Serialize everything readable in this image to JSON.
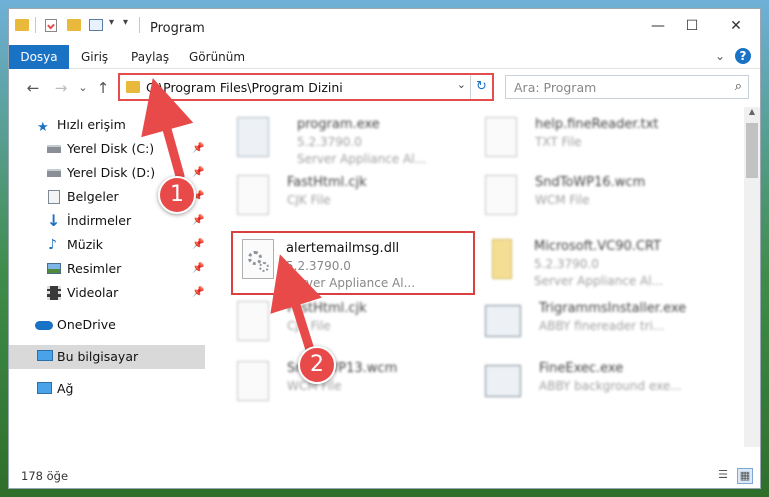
{
  "window": {
    "title": "Program",
    "controls": {
      "minimize": "—",
      "maximize": "☐",
      "close": "✕"
    }
  },
  "ribbon": {
    "tabs": [
      "Dosya",
      "Giriş",
      "Paylaş",
      "Görünüm"
    ],
    "expand": "⌄",
    "help": "?"
  },
  "nav": {
    "back": "←",
    "forward": "→",
    "recent": "⌄",
    "up": "↑",
    "address": "C:\\Program Files\\Program Dizini",
    "address_dropdown": "⌄",
    "refresh": "↻",
    "search_placeholder": "Ara: Program",
    "search_icon": "⌕"
  },
  "sidebar": {
    "quick_access": "Hızlı erişim",
    "items": [
      {
        "label": "Yerel Disk (C:)",
        "icon": "drive-icon",
        "pinned": true
      },
      {
        "label": "Yerel Disk (D:)",
        "icon": "drive-icon",
        "pinned": true
      },
      {
        "label": "Belgeler",
        "icon": "document-icon",
        "pinned": true
      },
      {
        "label": "İndirmeler",
        "icon": "download-icon",
        "pinned": true
      },
      {
        "label": "Müzik",
        "icon": "music-icon",
        "pinned": true
      },
      {
        "label": "Resimler",
        "icon": "picture-icon",
        "pinned": true
      },
      {
        "label": "Videolar",
        "icon": "video-icon",
        "pinned": true
      }
    ],
    "onedrive": "OneDrive",
    "this_pc": "Bu bilgisayar",
    "network": "Ağ",
    "pin_glyph": "📌"
  },
  "files": [
    {
      "name": "program.exe",
      "line2": "5.2.3790.0",
      "line3": "Server Appliance Al...",
      "blurred": true
    },
    {
      "name": "help.fineReader.txt",
      "line2": "TXT File",
      "line3": "",
      "blurred": true
    },
    {
      "name": "FastHtml.cjk",
      "line2": "CJK File",
      "line3": "",
      "blurred": true
    },
    {
      "name": "SndToWP16.wcm",
      "line2": "WCM File",
      "line3": "",
      "blurred": true
    },
    {
      "name": "alertemailmsg.dll",
      "line2": "5.2.3790.0",
      "line3": "Server Appliance Al...",
      "blurred": false
    },
    {
      "name": "Microsoft.VC90.CRT",
      "line2": "5.2.3790.0",
      "line3": "Server Appliance Al...",
      "blurred": true
    },
    {
      "name": "FastHtml.cjk",
      "line2": "CJK File",
      "line3": "",
      "blurred": true
    },
    {
      "name": "TrigrammsInstaller.exe",
      "line2": "ABBY finereader tri...",
      "line3": "",
      "blurred": true
    },
    {
      "name": "SndToWP13.wcm",
      "line2": "WCM File",
      "line3": "",
      "blurred": true
    },
    {
      "name": "FineExec.exe",
      "line2": "ABBY background exe...",
      "line3": "",
      "blurred": true
    }
  ],
  "status": {
    "count": "178 öğe"
  },
  "annotations": {
    "step1": "1",
    "step2": "2"
  },
  "colors": {
    "accent": "#1a72c4",
    "annotation": "#e84a4a",
    "folder": "#e8b93b"
  }
}
